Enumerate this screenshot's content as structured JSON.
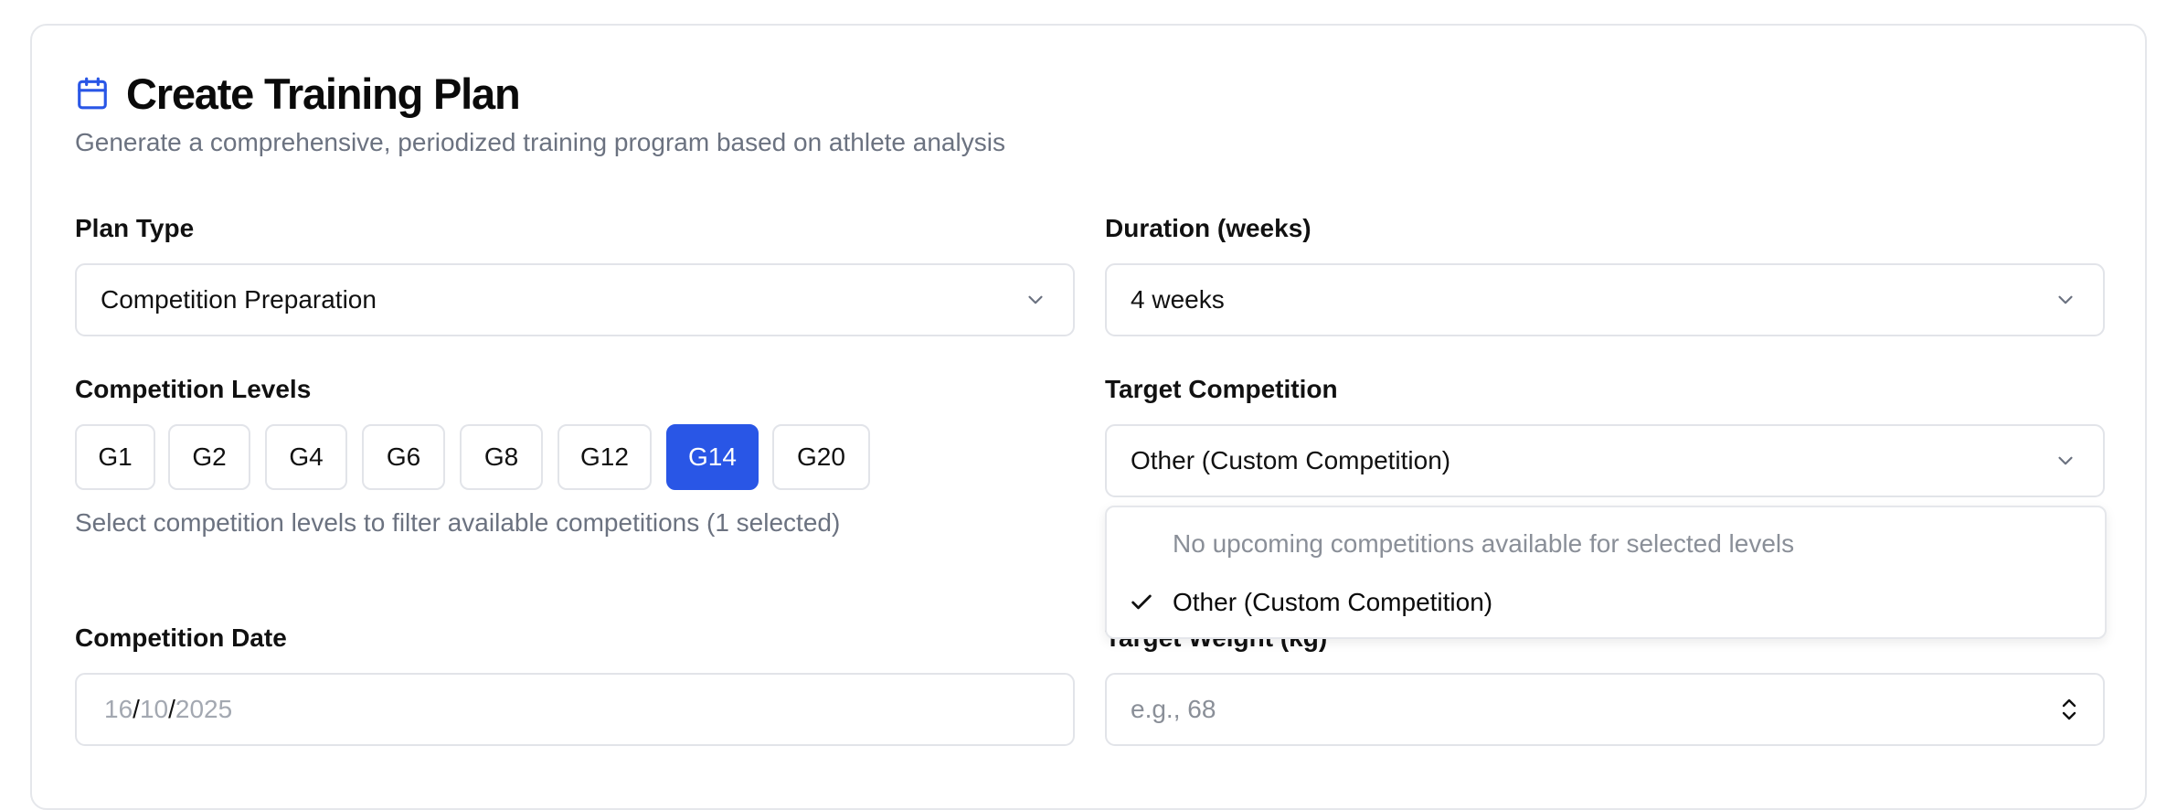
{
  "header": {
    "title": "Create Training Plan",
    "subtitle": "Generate a comprehensive, periodized training program based on athlete analysis",
    "icon": "calendar-icon",
    "accent_color": "#2956e6"
  },
  "plan_type": {
    "label": "Plan Type",
    "value": "Competition Preparation"
  },
  "duration": {
    "label": "Duration (weeks)",
    "value": "4 weeks"
  },
  "competition_levels": {
    "label": "Competition Levels",
    "options": [
      "G1",
      "G2",
      "G4",
      "G6",
      "G8",
      "G12",
      "G14",
      "G20"
    ],
    "selected": "G14",
    "hint": "Select competition levels to filter available competitions (1 selected)"
  },
  "target_competition": {
    "label": "Target Competition",
    "value": "Other (Custom Competition)",
    "dropdown": {
      "empty_message": "No upcoming competitions available for selected levels",
      "options": [
        {
          "label": "Other (Custom Competition)",
          "checked": true
        }
      ]
    }
  },
  "competition_date": {
    "label": "Competition Date",
    "day": "16",
    "month": "10",
    "year": "2025",
    "separator": "/"
  },
  "target_weight": {
    "label": "Target Weight (kg)",
    "placeholder": "e.g., 68"
  }
}
